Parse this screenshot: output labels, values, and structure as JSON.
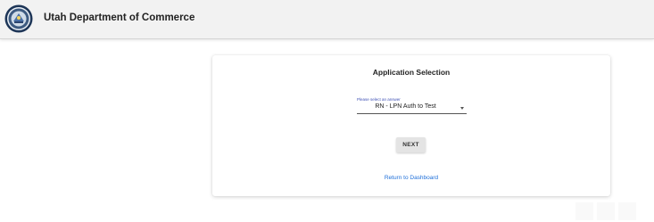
{
  "header": {
    "title": "Utah Department of Commerce",
    "logo_icon": "state-seal-icon"
  },
  "card": {
    "title": "Application Selection",
    "select": {
      "label": "Please select an answer",
      "value": "RN - LPN Auth to Test",
      "icon": "chevron-down-icon"
    },
    "next_label": "NEXT",
    "return_link": "Return to Dashboard"
  },
  "colors": {
    "header_bg": "#f2f2f2",
    "select_label": "#3f51b5",
    "link": "#1e6fd9",
    "button_bg": "#e4e4e4"
  }
}
